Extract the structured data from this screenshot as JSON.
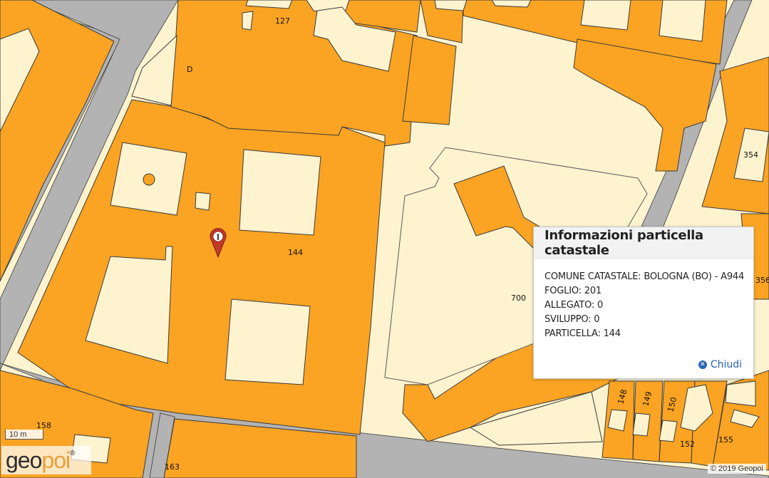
{
  "map": {
    "parcel_labels": [
      {
        "id": "p127",
        "text": "127"
      },
      {
        "id": "pD",
        "text": "D"
      },
      {
        "id": "p144",
        "text": "144"
      },
      {
        "id": "p354",
        "text": "354"
      },
      {
        "id": "p356",
        "text": "356"
      },
      {
        "id": "p700",
        "text": "700"
      },
      {
        "id": "p148",
        "text": "148"
      },
      {
        "id": "p149",
        "text": "149"
      },
      {
        "id": "p150",
        "text": "150"
      },
      {
        "id": "p152",
        "text": "152"
      },
      {
        "id": "p155",
        "text": "155"
      },
      {
        "id": "p158",
        "text": "158"
      },
      {
        "id": "p163",
        "text": "163"
      }
    ],
    "colors": {
      "building": "#fba423",
      "courtyard": "#fdf3cf",
      "street": "#b3b3b3",
      "outline": "#3a3a3a",
      "marker": "#c0392b"
    }
  },
  "scale": {
    "label": "10 m"
  },
  "logo": {
    "dark": "geo",
    "light": "poi",
    "reg": "®"
  },
  "attribution": "© 2019 Geopoi",
  "marker": {
    "icon": "info-pin-icon",
    "letter": "I"
  },
  "popup": {
    "title": "Informazioni particella catastale",
    "lines": [
      "COMUNE CATASTALE: BOLOGNA (BO) - A944",
      "FOGLIO: 201",
      "ALLEGATO: 0",
      "SVILUPPO: 0",
      "PARTICELLA: 144"
    ],
    "close_label": "Chiudi",
    "close_icon": "close-circle-icon"
  }
}
